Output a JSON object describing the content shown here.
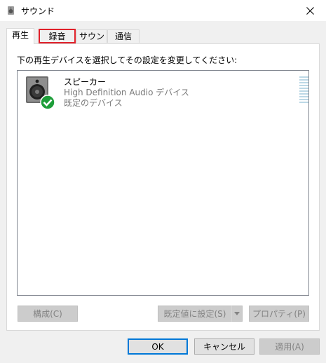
{
  "window": {
    "title": "サウンド",
    "title_icon": "speaker-icon",
    "close_icon": "close-icon"
  },
  "tabs": [
    {
      "label": "再生",
      "active": true
    },
    {
      "label": "録音",
      "active": false,
      "highlighted": true
    },
    {
      "label": "サウンド",
      "active": false
    },
    {
      "label": "通信",
      "active": false
    }
  ],
  "panel": {
    "instruction": "下の再生デバイスを選択してその設定を変更してください:",
    "devices": [
      {
        "name": "スピーカー",
        "description": "High Definition Audio デバイス",
        "status": "既定のデバイス",
        "icon": "speaker-icon",
        "badge": "check-icon"
      }
    ],
    "buttons": {
      "configure": "構成(C)",
      "set_default": "既定値に設定(S)",
      "properties": "プロパティ(P)"
    }
  },
  "footer": {
    "ok": "OK",
    "cancel": "キャンセル",
    "apply": "適用(A)"
  },
  "colors": {
    "highlight": "#e0212a",
    "default_button_border": "#0078d7",
    "check_badge": "#1e9e3a",
    "meter": "#bcd8e6"
  }
}
